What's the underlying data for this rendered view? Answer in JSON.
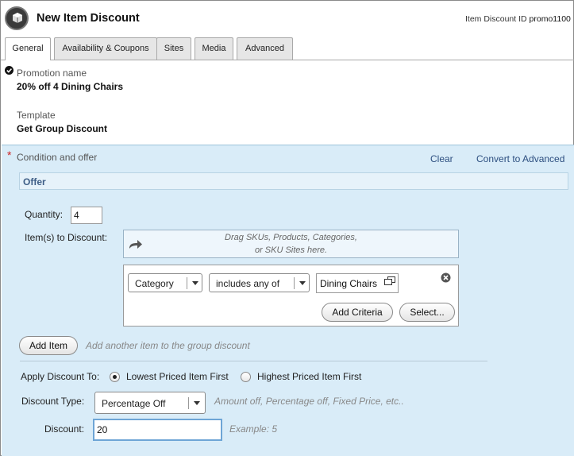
{
  "header": {
    "title": "New Item Discount",
    "id_label": "Item Discount ID",
    "id_value": "promo1100"
  },
  "tabs": [
    {
      "label": "General",
      "active": true
    },
    {
      "label": "Availability & Coupons",
      "active": false
    },
    {
      "label": "Sites",
      "active": false
    },
    {
      "label": "Media",
      "active": false
    },
    {
      "label": "Advanced",
      "active": false
    }
  ],
  "general": {
    "promotion_name_label": "Promotion name",
    "promotion_name_value": "20% off 4 Dining Chairs",
    "template_label": "Template",
    "template_value": "Get Group Discount"
  },
  "condition": {
    "required_marker": "*",
    "section_label": "Condition and offer",
    "clear_link": "Clear",
    "convert_link": "Convert to Advanced",
    "offer_header": "Offer"
  },
  "offer": {
    "quantity_label": "Quantity:",
    "quantity_value": "4",
    "items_label": "Item(s) to Discount:",
    "drop_line1": "Drag SKUs, Products, Categories,",
    "drop_line2": "or SKU Sites here.",
    "criteria": {
      "field_value": "Category",
      "operator_value": "includes any of",
      "target_value": "Dining Chairs"
    },
    "add_criteria_button": "Add Criteria",
    "select_button": "Select...",
    "add_item_button": "Add Item",
    "add_item_hint": "Add another item to the group discount"
  },
  "discount": {
    "apply_label": "Apply Discount To:",
    "option_lowest": "Lowest Priced Item First",
    "option_highest": "Highest Priced Item First",
    "selected_option": "lowest",
    "type_label": "Discount Type:",
    "type_value": "Percentage Off",
    "type_hint": "Amount off, Percentage off, Fixed Price, etc..",
    "amount_label": "Discount:",
    "amount_value": "20",
    "amount_hint": "Example: 5"
  },
  "colors": {
    "section_background": "#d9ecf8",
    "link": "#2d4f80",
    "required": "#cc2222"
  }
}
